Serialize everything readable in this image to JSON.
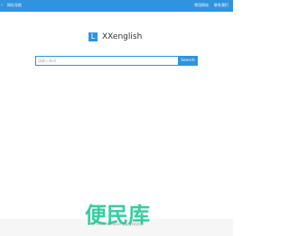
{
  "header": {
    "back_glyph": "‹",
    "title": "网址导航",
    "links": [
      "常用网站",
      "联系我们"
    ]
  },
  "logo": {
    "mark": "L",
    "text": "XXenglish"
  },
  "search": {
    "placeholder": "请输入单词",
    "button_label": "Search"
  },
  "footer": {
    "text": "© 2024 XXenglish 保留所有权利"
  },
  "watermark": {
    "text": "便民库"
  },
  "colors": {
    "accent": "#2f93df",
    "watermark": "#20c997"
  }
}
